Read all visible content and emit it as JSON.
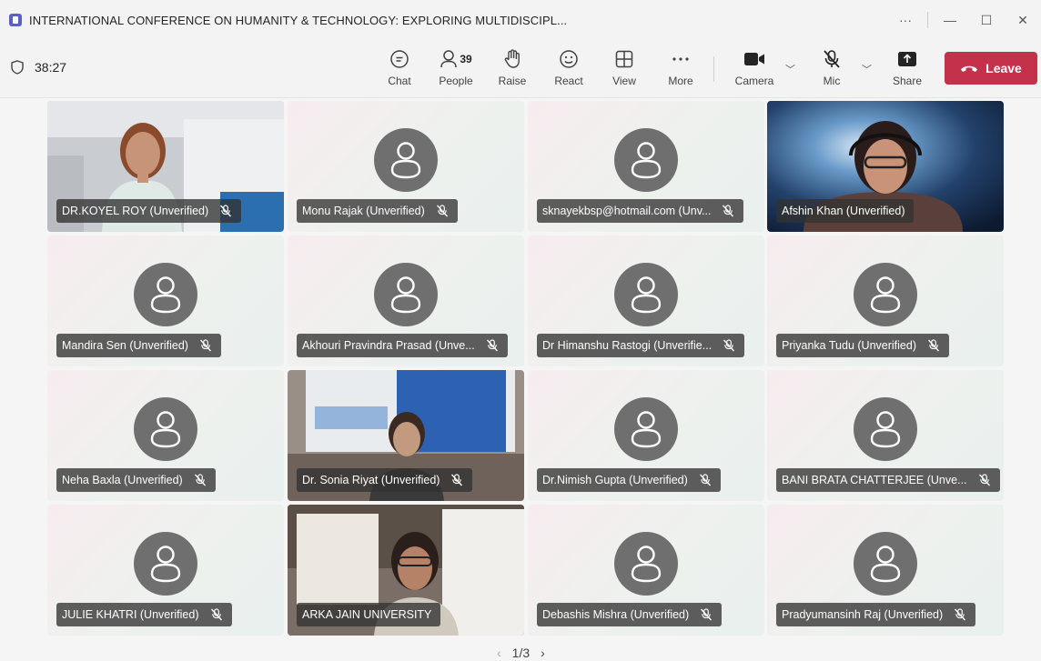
{
  "window": {
    "title": "INTERNATIONAL CONFERENCE ON HUMANITY & TECHNOLOGY: EXPLORING MULTIDISCIPL...",
    "more": "···",
    "minimize": "—",
    "maximize": "☐",
    "close": "✕"
  },
  "toolbar": {
    "timer": "38:27",
    "chat": "Chat",
    "people": "People",
    "people_count": "39",
    "raise": "Raise",
    "react": "React",
    "view": "View",
    "more": "More",
    "camera": "Camera",
    "mic": "Mic",
    "share": "Share",
    "leave": "Leave"
  },
  "participants": [
    {
      "name": "DR.KOYEL ROY (Unverified)",
      "video": true,
      "muted": true
    },
    {
      "name": "Monu Rajak (Unverified)",
      "video": false,
      "muted": true
    },
    {
      "name": "sknayekbsp@hotmail.com (Unv...",
      "video": false,
      "muted": true
    },
    {
      "name": "Afshin Khan (Unverified)",
      "video": true,
      "muted": false
    },
    {
      "name": "Mandira Sen (Unverified)",
      "video": false,
      "muted": true
    },
    {
      "name": "Akhouri Pravindra Prasad (Unve...",
      "video": false,
      "muted": true
    },
    {
      "name": "Dr Himanshu Rastogi (Unverifie...",
      "video": false,
      "muted": true
    },
    {
      "name": "Priyanka Tudu (Unverified)",
      "video": false,
      "muted": true
    },
    {
      "name": "Neha Baxla (Unverified)",
      "video": false,
      "muted": true
    },
    {
      "name": "Dr. Sonia Riyat (Unverified)",
      "video": true,
      "muted": true
    },
    {
      "name": "Dr.Nimish Gupta (Unverified)",
      "video": false,
      "muted": true
    },
    {
      "name": "BANI BRATA CHATTERJEE (Unve...",
      "video": false,
      "muted": true
    },
    {
      "name": "JULIE KHATRI (Unverified)",
      "video": false,
      "muted": true
    },
    {
      "name": "ARKA JAIN UNIVERSITY",
      "video": true,
      "muted": false
    },
    {
      "name": "Debashis Mishra (Unverified)",
      "video": false,
      "muted": true
    },
    {
      "name": "Pradyumansinh Raj (Unverified)",
      "video": false,
      "muted": true
    }
  ],
  "pager": {
    "prev": "‹",
    "label": "1/3",
    "next": "›"
  },
  "colors": {
    "accent": "#5b5fc7",
    "leave": "#c4314b",
    "avatar_bg": "#6f6f6f"
  }
}
